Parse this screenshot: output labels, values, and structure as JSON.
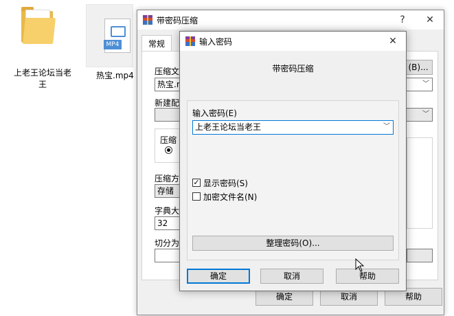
{
  "desktop": {
    "folder_label_line1": "上老王论坛当老",
    "folder_label_line2": "王",
    "file_badge": "MP4",
    "file_label": "热宝.mp4"
  },
  "main_dialog": {
    "title": "带密码压缩",
    "help_glyph": "?",
    "close_glyph": "✕",
    "tab_general": "常规",
    "label_archive": "压缩文",
    "browse_button": "(B)...",
    "archive_value": "热宝.r",
    "label_profile": "新建配",
    "label_format": "压缩",
    "label_method": "压缩方",
    "method_value": "存储",
    "label_dict": "字典大",
    "dict_value": "32",
    "label_split": "切分为",
    "ok_button": "确定",
    "cancel_button": "取消",
    "help_button": "帮助"
  },
  "password_dialog": {
    "title": "输入密码",
    "close_glyph": "✕",
    "heading": "带密码压缩",
    "input_label": "输入密码(E)",
    "password_value": "上老王论坛当老王",
    "show_password_label": "显示密码(S)",
    "show_password_checked": "✓",
    "encrypt_names_label": "加密文件名(N)",
    "organize_button": "整理密码(O)...",
    "ok_button": "确定",
    "cancel_button": "取消",
    "help_button": "帮助"
  }
}
